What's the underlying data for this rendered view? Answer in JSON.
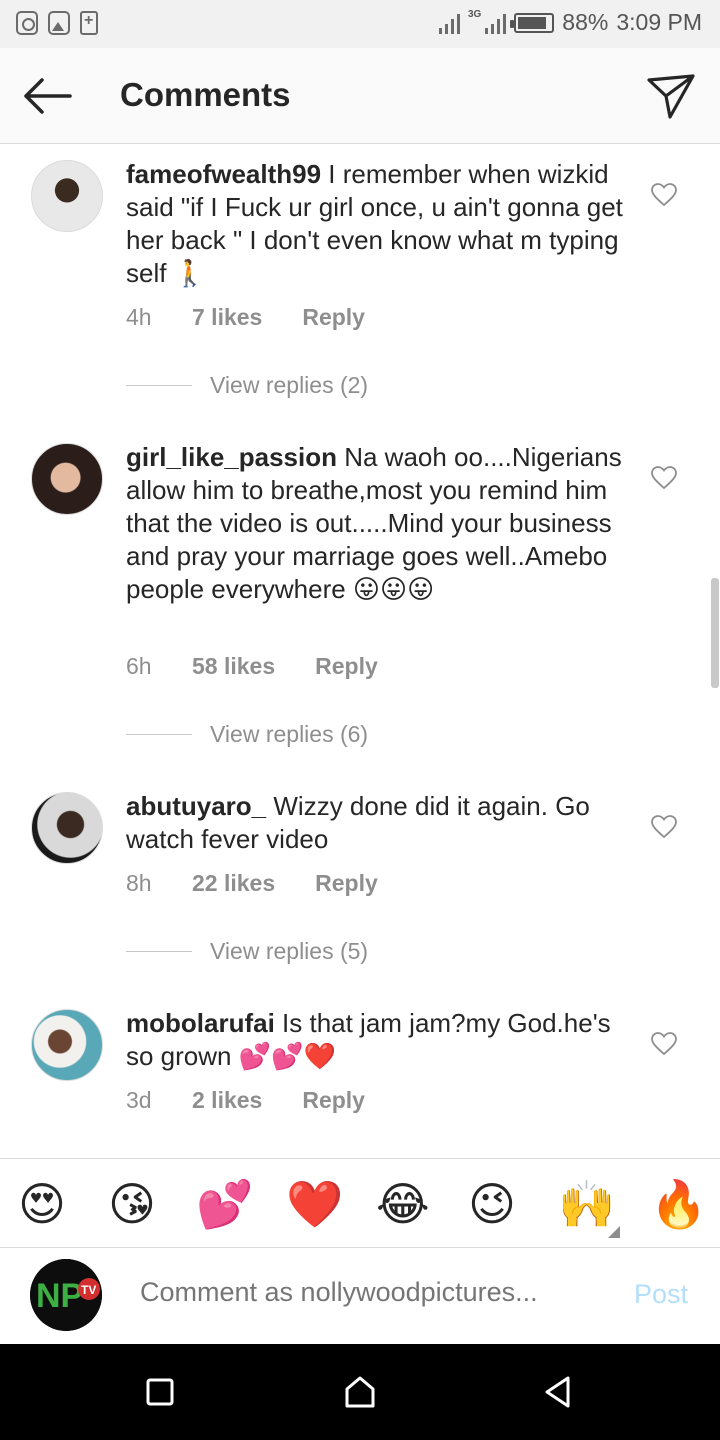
{
  "status_bar": {
    "network": "3G",
    "battery": "88%",
    "battery_level": 0.88,
    "time": "3:09 PM"
  },
  "header": {
    "title": "Comments",
    "back_icon": "arrow-left-icon",
    "send_icon": "paper-plane-icon"
  },
  "comments": [
    {
      "username": "fameofwealth99",
      "text": " I remember when wizkid said \"if I Fuck ur girl once, u ain't gonna get her back \"  I don't even know what m typing self 🚶",
      "time": "4h",
      "likes": "7 likes",
      "reply": "Reply",
      "view_replies": "View replies (2)"
    },
    {
      "username": "girl_like_passion",
      "text": " Na waoh oo....Nigerians allow him to breathe,most you remind him that the video is out.....Mind your business and pray your marriage goes well..Amebo people everywhere 😛😛😛",
      "time": "6h",
      "likes": "58 likes",
      "reply": "Reply",
      "view_replies": "View replies (6)"
    },
    {
      "username": "abutuyaro_",
      "text": " Wizzy done did it again. Go watch fever video",
      "time": "8h",
      "likes": "22 likes",
      "reply": "Reply",
      "view_replies": "View replies (5)"
    },
    {
      "username": "mobolarufai",
      "text": " Is that jam jam?my God.he's so grown 💕💕❤️",
      "time": "3d",
      "likes": "2 likes",
      "reply": "Reply"
    }
  ],
  "emoji_bar": [
    "😍",
    "😘",
    "💕",
    "❤️",
    "😂",
    "😉",
    "🙌",
    "🔥"
  ],
  "compose": {
    "placeholder": "Comment as nollywoodpictures...",
    "post_label": "Post",
    "avatar_text": "NP",
    "avatar_badge": "TV"
  },
  "nav": {
    "recents_icon": "square-icon",
    "home_icon": "home-icon",
    "back_icon": "triangle-back-icon"
  }
}
